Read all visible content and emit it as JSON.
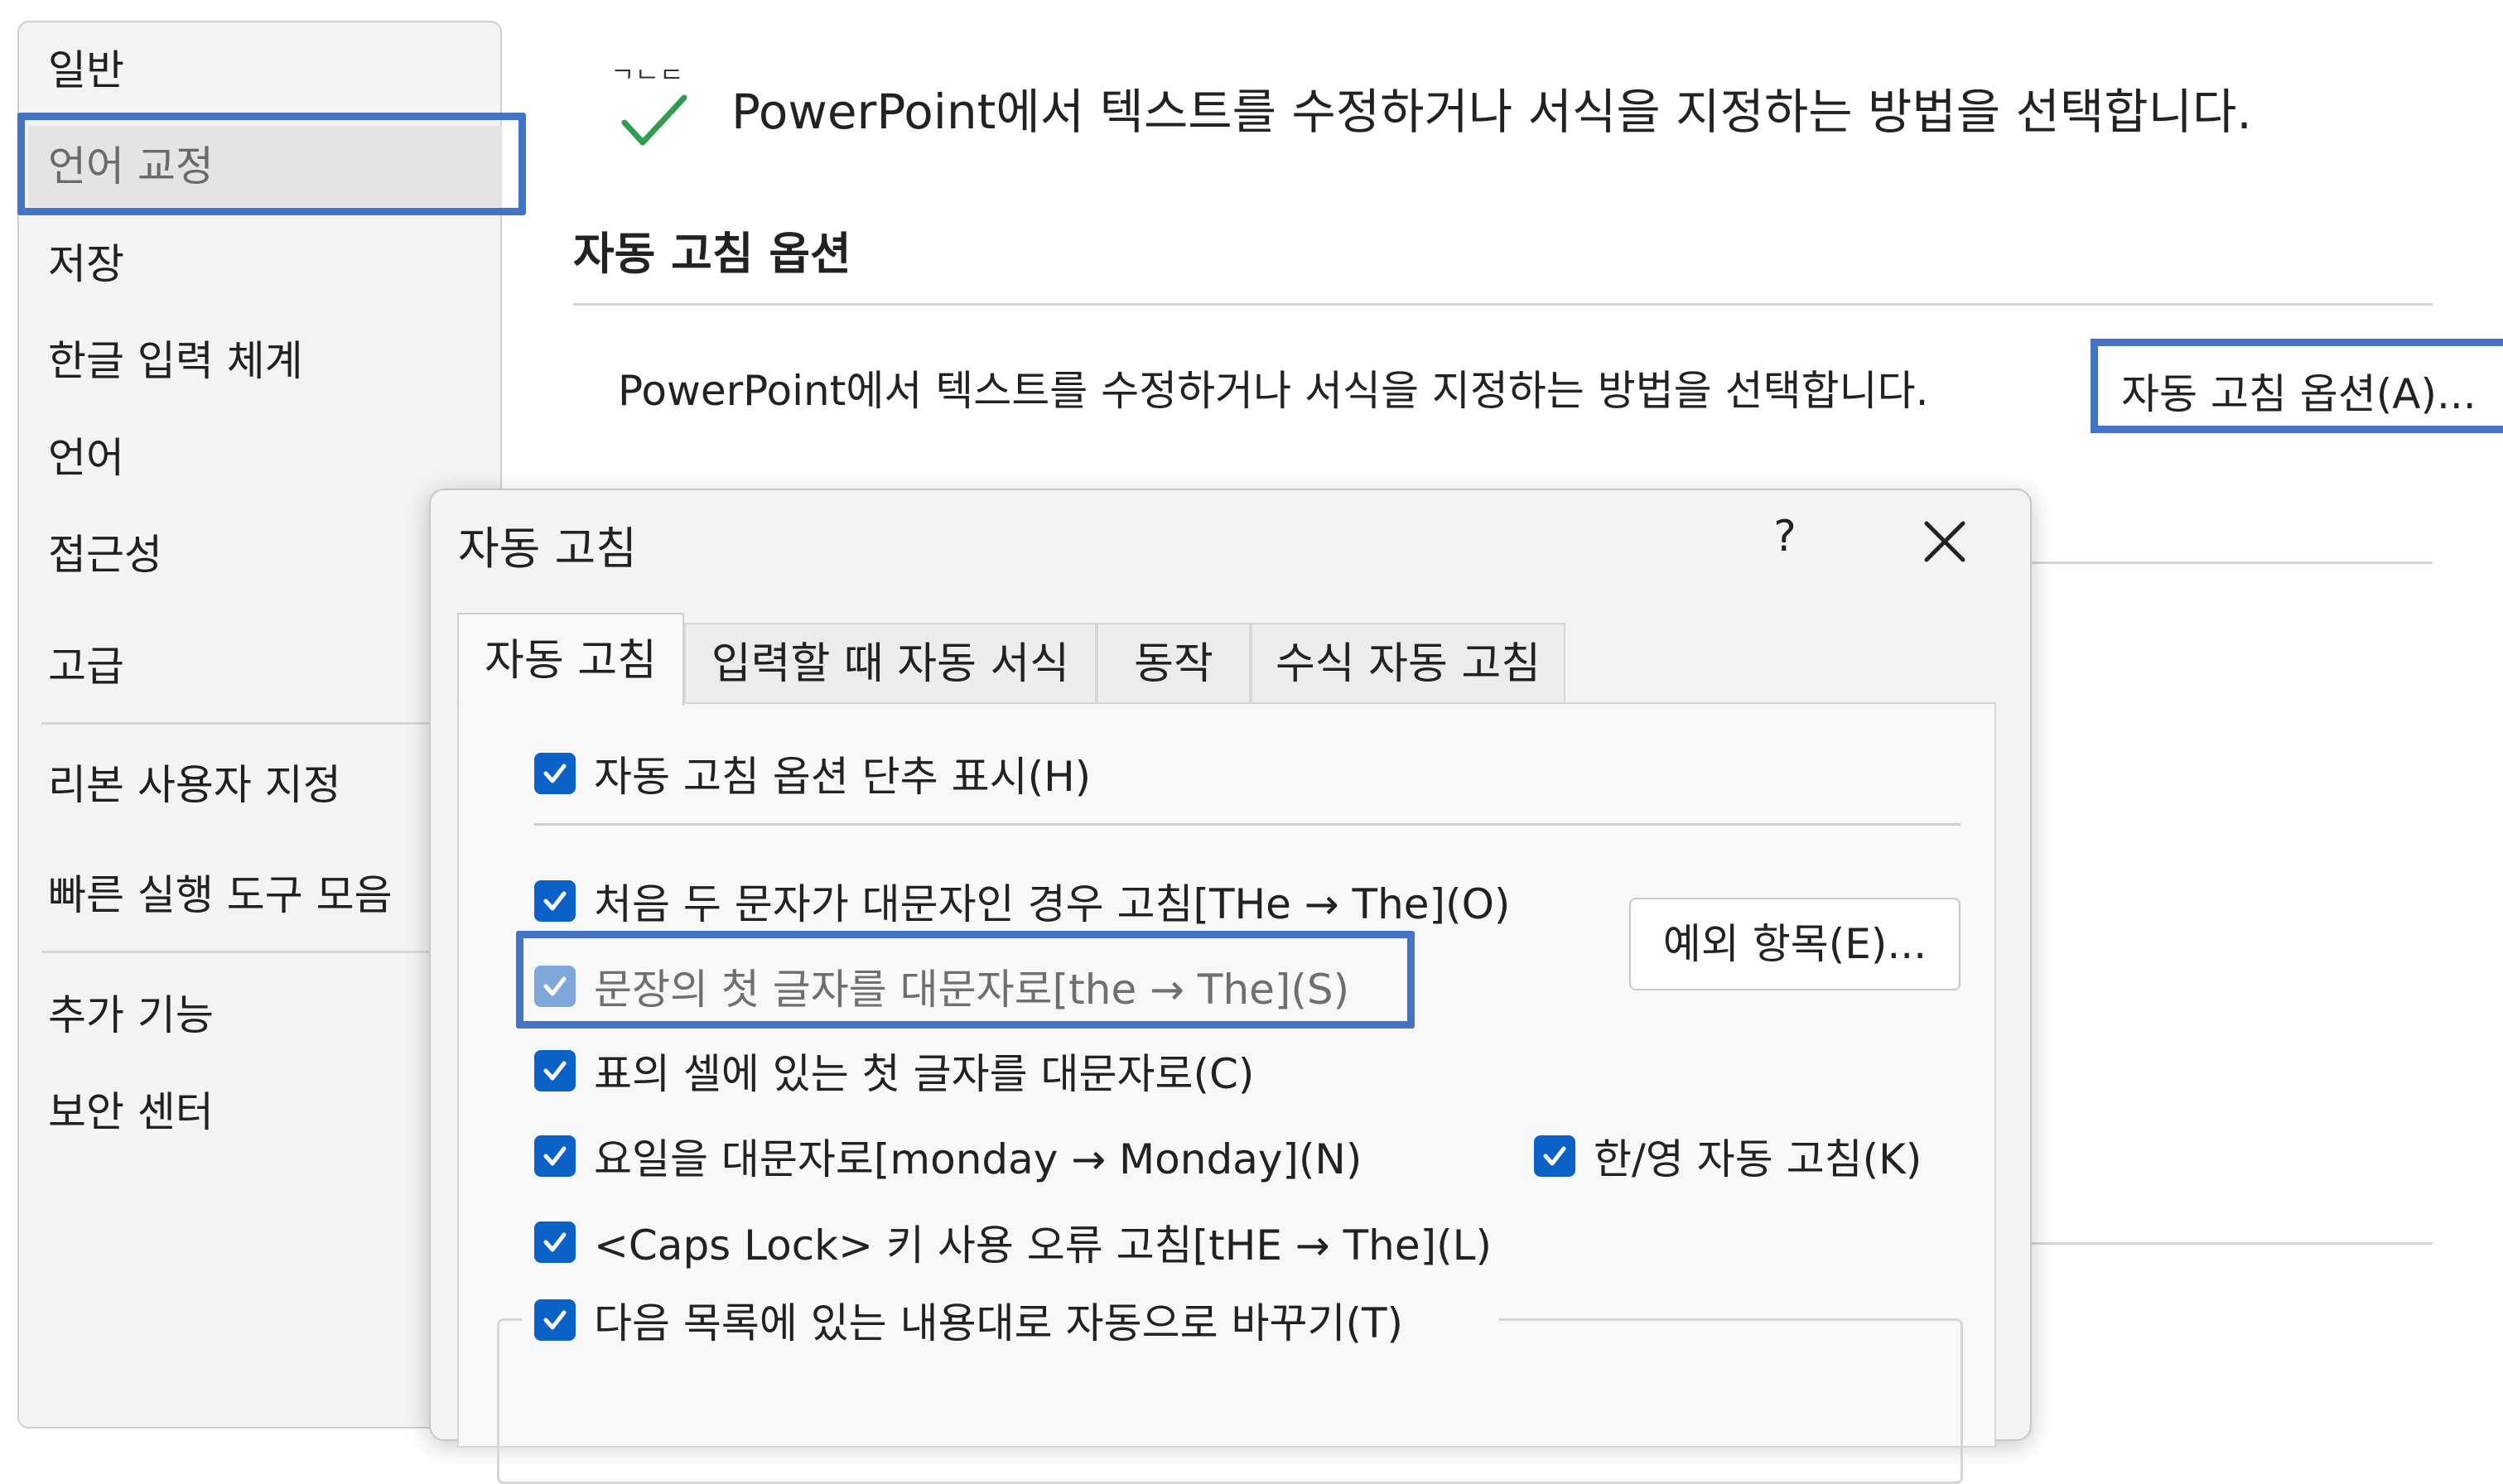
{
  "nav": {
    "items": [
      {
        "label": "일반"
      },
      {
        "label": "언어 교정"
      },
      {
        "label": "저장"
      },
      {
        "label": "한글 입력 체계"
      },
      {
        "label": "언어"
      },
      {
        "label": "접근성"
      },
      {
        "label": "고급"
      },
      {
        "label": "리본 사용자 지정"
      },
      {
        "label": "빠른 실행 도구 모음"
      },
      {
        "label": "추가 기능"
      },
      {
        "label": "보안 센터"
      }
    ],
    "selected": "언어 교정"
  },
  "content": {
    "header_glyph": "ᄀᄂᄃ",
    "header_text": "PowerPoint에서 텍스트를 수정하거나 서식을 지정하는 방법을 선택합니다.",
    "section_title": "자동 고침 옵션",
    "description": "PowerPoint에서 텍스트를 수정하거나 서식을 지정하는 방법을 선택합니다.",
    "autocorrect_options_button": "자동 고침 옵션(A)..."
  },
  "dialog": {
    "title": "자동 고침",
    "help_label": "?",
    "tabs": [
      {
        "label": "자동 고침",
        "active": true
      },
      {
        "label": "입력할 때 자동 서식",
        "active": false
      },
      {
        "label": "동작",
        "active": false
      },
      {
        "label": "수식 자동 고침",
        "active": false
      }
    ],
    "options": {
      "show_buttons": {
        "label": "자동 고침 옵션 단추 표시(H)",
        "checked": true
      },
      "two_initial_caps": {
        "label": "처음 두 문자가 대문자인 경우 고침[THe → The](O)",
        "checked": true
      },
      "capitalize_sentences": {
        "label": "문장의 첫 글자를 대문자로[the → The](S)",
        "checked": true
      },
      "capitalize_table_cells": {
        "label": "표의 셀에 있는 첫 글자를 대문자로(C)",
        "checked": true
      },
      "capitalize_days": {
        "label": "요일을 대문자로[monday → Monday](N)",
        "checked": true
      },
      "korean_english": {
        "label": "한/영 자동 고침(K)",
        "checked": true
      },
      "caps_lock": {
        "label": "<Caps Lock> 키 사용 오류 고침[tHE → The](L)",
        "checked": true
      },
      "replace_text": {
        "label": "다음 목록에 있는 내용대로 자동으로 바꾸기(T)",
        "checked": true
      }
    },
    "exceptions_button": "예외 항목(E)..."
  },
  "colors": {
    "callout": "#4472c4",
    "checkbox": "#0a62c6",
    "check_accent": "#2e9d4f"
  }
}
